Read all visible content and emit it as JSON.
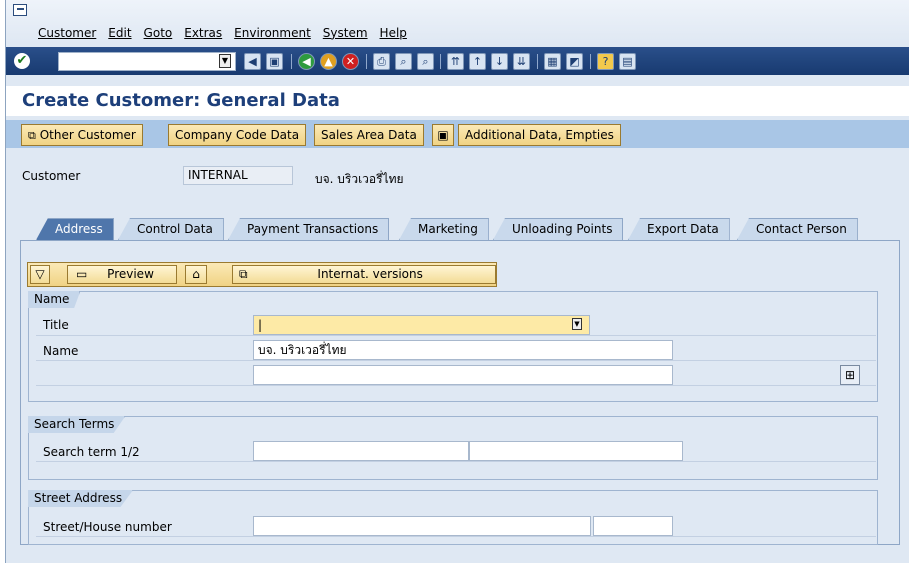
{
  "menu": [
    "Customer",
    "Edit",
    "Goto",
    "Extras",
    "Environment",
    "System",
    "Help"
  ],
  "title": "Create Customer: General Data",
  "app_buttons": [
    "Other Customer",
    "Company Code Data",
    "Sales Area Data",
    "Additional Data, Empties"
  ],
  "customer": {
    "label": "Customer",
    "value": "INTERNAL",
    "name": "บจ. บริวเวอรี่ไทย"
  },
  "tabs": [
    "Address",
    "Control Data",
    "Payment Transactions",
    "Marketing",
    "Unloading Points",
    "Export Data",
    "Contact Person"
  ],
  "inner_buttons": {
    "preview": "Preview",
    "intl": "Internat. versions"
  },
  "name_group": {
    "header": "Name",
    "title_label": "Title",
    "name_label": "Name",
    "name_value": "บจ. บริวเวอรี่ไทย",
    "title_value": ""
  },
  "search_group": {
    "header": "Search Terms",
    "label": "Search term 1/2"
  },
  "street_group": {
    "header": "Street Address",
    "label": "Street/House number"
  }
}
